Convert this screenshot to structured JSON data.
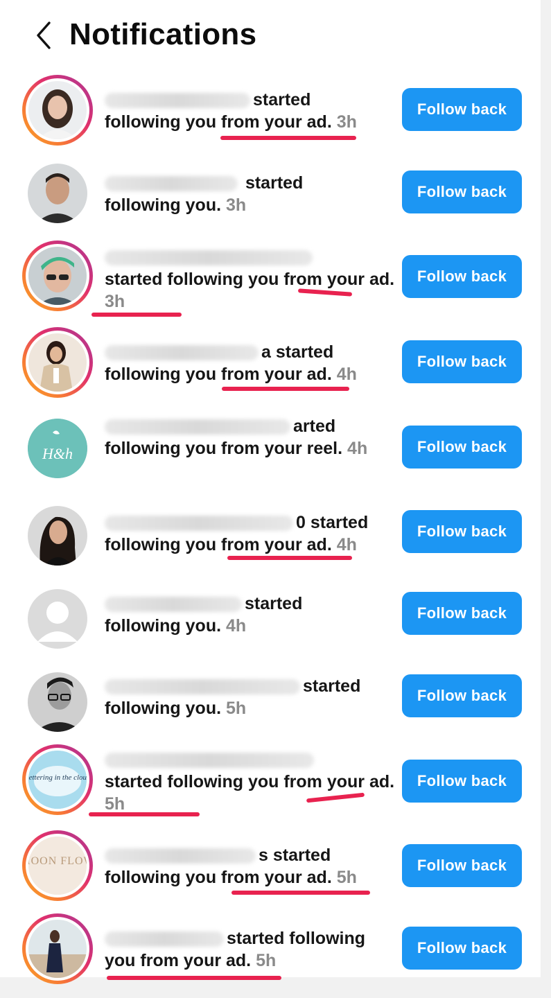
{
  "header": {
    "title": "Notifications"
  },
  "notifications": [
    {
      "name": "viktoria_denis",
      "name_tail": "started",
      "text": "following you from your ad.",
      "time": "3h",
      "button": "Follow back"
    },
    {
      "name": "kkvoyyarfer",
      "name_tail": "started",
      "text": "following you.",
      "time": "3h",
      "button": "Follow back"
    },
    {
      "name": "lady_stealthy_wealthy",
      "name_tail": "",
      "text": "started following you from your ad.",
      "time": "3h",
      "button": "Follow back"
    },
    {
      "name": "bettinadimitrova",
      "name_tail": "a started",
      "text": "following you from your ad.",
      "time": "4h",
      "button": "Follow back"
    },
    {
      "name": "help_and_harmony",
      "name_tail": "arted",
      "text": "following you from your reel.",
      "time": "4h",
      "button": "Follow back"
    },
    {
      "name": "laura_lopes_16144",
      "name_tail": "0 started",
      "text": "following you from your ad.",
      "time": "4h",
      "button": "Follow back"
    },
    {
      "name": "bbeymircayo",
      "name_tail": "started",
      "text": "following you.",
      "time": "4h",
      "button": "Follow back"
    },
    {
      "name": "codewithimrankhan",
      "name_tail": "started",
      "text": "following you.",
      "time": "5h",
      "button": "Follow back"
    },
    {
      "name": "lettering_in_the_cloud",
      "name_tail": "",
      "text": "started following you from your ad.",
      "time": "5h",
      "button": "Follow back"
    },
    {
      "name": "moonflowergoles",
      "name_tail": "s started",
      "text": "following you from your ad.",
      "time": "5h",
      "button": "Follow back"
    },
    {
      "name": "meg_fitness",
      "name_tail": "started following",
      "text": "you from your ad.",
      "time": "5h",
      "button": "Follow back"
    }
  ],
  "avatar_labels": {
    "hh": "H&h",
    "lettering": "Lettering in the cloud",
    "moon": "MOON FLOW"
  },
  "colors": {
    "button": "#1c96f3",
    "underline": "#e8224f",
    "time": "#8a8a8a"
  }
}
